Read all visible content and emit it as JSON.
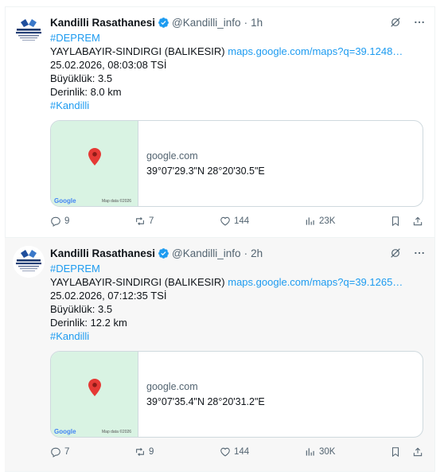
{
  "tweets": [
    {
      "author": "Kandilli Rasathanesi",
      "handle": "@Kandilli_info",
      "time": "1h",
      "hashtag1": "#DEPREM",
      "location": "YAYLABAYIR-SINDIRGI (BALIKESIR)",
      "link": "maps.google.com/maps?q=39.1248…",
      "datetime": "25.02.2026, 08:03:08 TSİ",
      "magnitude": "Büyüklük: 3.5",
      "depth": "Derinlik: 8.0 km",
      "hashtag2": "#Kandilli",
      "card_domain": "google.com",
      "card_coords": "39°07'29.3\"N 28°20'30.5\"E",
      "map_logo": "Google",
      "map_credit": "Map data ©2026",
      "replies": "9",
      "reposts": "7",
      "likes": "144",
      "views": "23K"
    },
    {
      "author": "Kandilli Rasathanesi",
      "handle": "@Kandilli_info",
      "time": "2h",
      "hashtag1": "#DEPREM",
      "location": "YAYLABAYIR-SINDIRGI (BALIKESIR)",
      "link": "maps.google.com/maps?q=39.1265…",
      "datetime": "25.02.2026, 07:12:35 TSİ",
      "magnitude": "Büyüklük: 3.5",
      "depth": "Derinlik: 12.2 km",
      "hashtag2": "#Kandilli",
      "card_domain": "google.com",
      "card_coords": "39°07'35.4\"N 28°20'31.2\"E",
      "map_logo": "Google",
      "map_credit": "Map data ©2026",
      "replies": "7",
      "reposts": "9",
      "likes": "144",
      "views": "30K"
    }
  ],
  "colors": {
    "accent": "#1d9bf0",
    "secondary_text": "#536471",
    "map_bg": "#d9f3e3",
    "pin": "#e53935"
  }
}
